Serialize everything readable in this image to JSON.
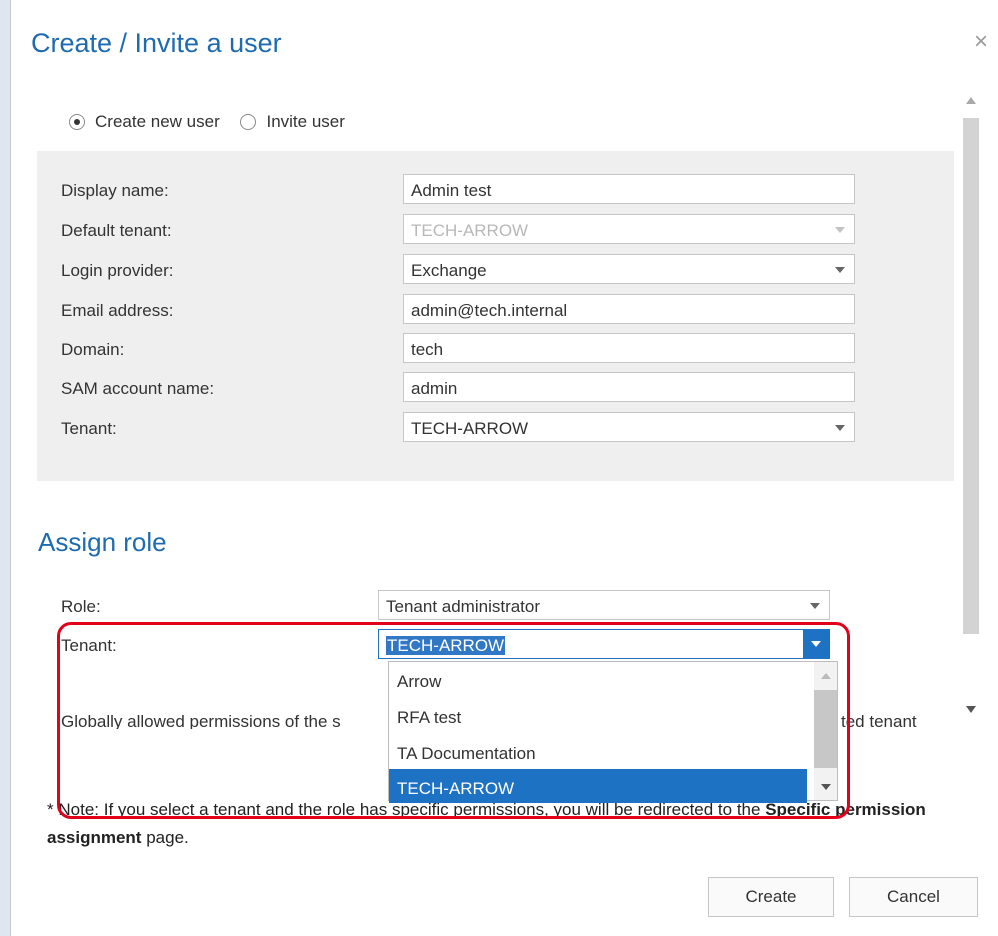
{
  "dialog": {
    "title": "Create / Invite a user",
    "close_symbol": "×"
  },
  "mode": {
    "options": [
      "Create new user",
      "Invite user"
    ],
    "selected": "Create new user"
  },
  "user_form": {
    "rows": [
      {
        "label": "Display name:",
        "value": "Admin test",
        "type": "text"
      },
      {
        "label": "Default tenant:",
        "value": "TECH-ARROW",
        "type": "select-disabled"
      },
      {
        "label": "Login provider:",
        "value": "Exchange",
        "type": "select"
      },
      {
        "label": "Email address:",
        "value": "admin@tech.internal",
        "type": "text"
      },
      {
        "label": "Domain:",
        "value": "tech",
        "type": "text"
      },
      {
        "label": "SAM account name:",
        "value": "admin",
        "type": "text"
      },
      {
        "label": "Tenant:",
        "value": "TECH-ARROW",
        "type": "select"
      }
    ]
  },
  "assign_role": {
    "title": "Assign role",
    "role_label": "Role:",
    "role_value": "Tenant administrator",
    "tenant_label": "Tenant:",
    "tenant_value": "TECH-ARROW",
    "tenant_options": [
      "Arrow",
      "RFA test",
      "TA Documentation",
      "TECH-ARROW"
    ],
    "tenant_selected": "TECH-ARROW",
    "obscured_text_left": "Globally allowed permissions of the s",
    "obscured_text_right": "ted tenant"
  },
  "note": {
    "prefix": "Note: If you select a tenant and the role has specific permissions, you will be redirected to the ",
    "bold": "Specific permission assignment",
    "suffix": " page.",
    "marker": "*"
  },
  "buttons": {
    "create": "Create",
    "cancel": "Cancel"
  },
  "colors": {
    "accent": "#1f6bb0",
    "selection": "#1e72c4",
    "highlight": "#e3001b"
  }
}
